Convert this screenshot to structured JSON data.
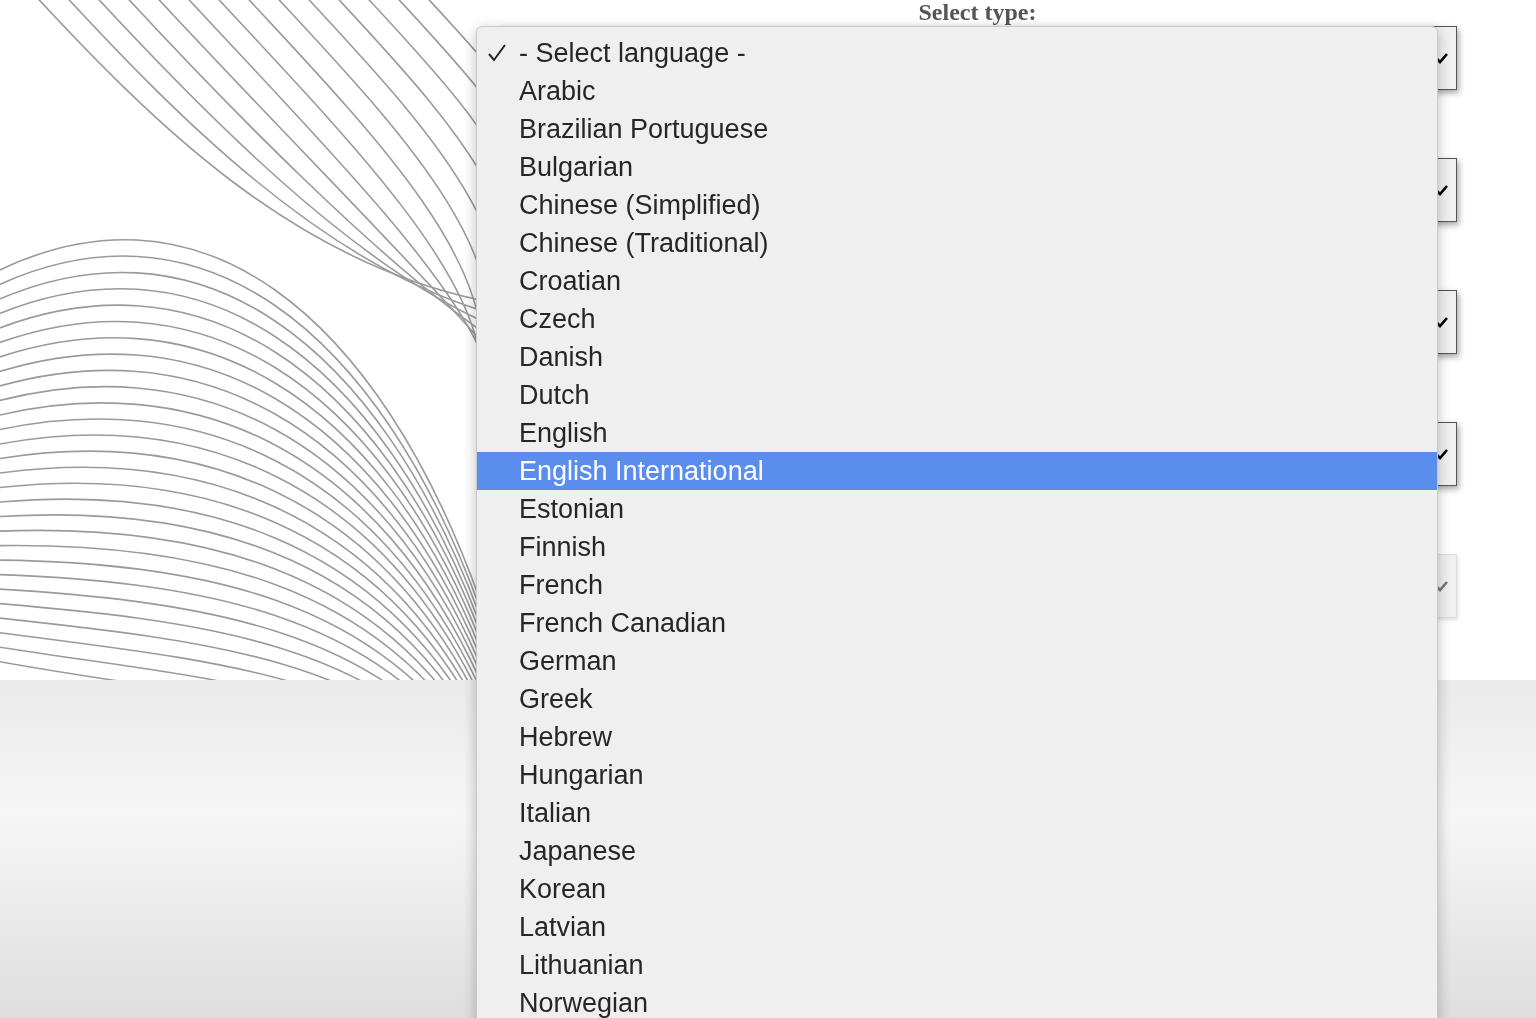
{
  "heading": "Select type:",
  "selects": [
    {
      "disabled": false
    },
    {
      "disabled": false
    },
    {
      "disabled": false
    },
    {
      "disabled": false
    },
    {
      "disabled": true
    }
  ],
  "language_menu": {
    "items": [
      {
        "label": "- Select language -",
        "checked": true,
        "selected": false
      },
      {
        "label": "Arabic",
        "checked": false,
        "selected": false
      },
      {
        "label": "Brazilian Portuguese",
        "checked": false,
        "selected": false
      },
      {
        "label": "Bulgarian",
        "checked": false,
        "selected": false
      },
      {
        "label": "Chinese (Simplified)",
        "checked": false,
        "selected": false
      },
      {
        "label": "Chinese (Traditional)",
        "checked": false,
        "selected": false
      },
      {
        "label": "Croatian",
        "checked": false,
        "selected": false
      },
      {
        "label": "Czech",
        "checked": false,
        "selected": false
      },
      {
        "label": "Danish",
        "checked": false,
        "selected": false
      },
      {
        "label": "Dutch",
        "checked": false,
        "selected": false
      },
      {
        "label": "English",
        "checked": false,
        "selected": false
      },
      {
        "label": "English International",
        "checked": false,
        "selected": true
      },
      {
        "label": "Estonian",
        "checked": false,
        "selected": false
      },
      {
        "label": "Finnish",
        "checked": false,
        "selected": false
      },
      {
        "label": "French",
        "checked": false,
        "selected": false
      },
      {
        "label": "French Canadian",
        "checked": false,
        "selected": false
      },
      {
        "label": "German",
        "checked": false,
        "selected": false
      },
      {
        "label": "Greek",
        "checked": false,
        "selected": false
      },
      {
        "label": "Hebrew",
        "checked": false,
        "selected": false
      },
      {
        "label": "Hungarian",
        "checked": false,
        "selected": false
      },
      {
        "label": "Italian",
        "checked": false,
        "selected": false
      },
      {
        "label": "Japanese",
        "checked": false,
        "selected": false
      },
      {
        "label": "Korean",
        "checked": false,
        "selected": false
      },
      {
        "label": "Latvian",
        "checked": false,
        "selected": false
      },
      {
        "label": "Lithuanian",
        "checked": false,
        "selected": false
      },
      {
        "label": "Norwegian",
        "checked": false,
        "selected": false
      }
    ]
  }
}
